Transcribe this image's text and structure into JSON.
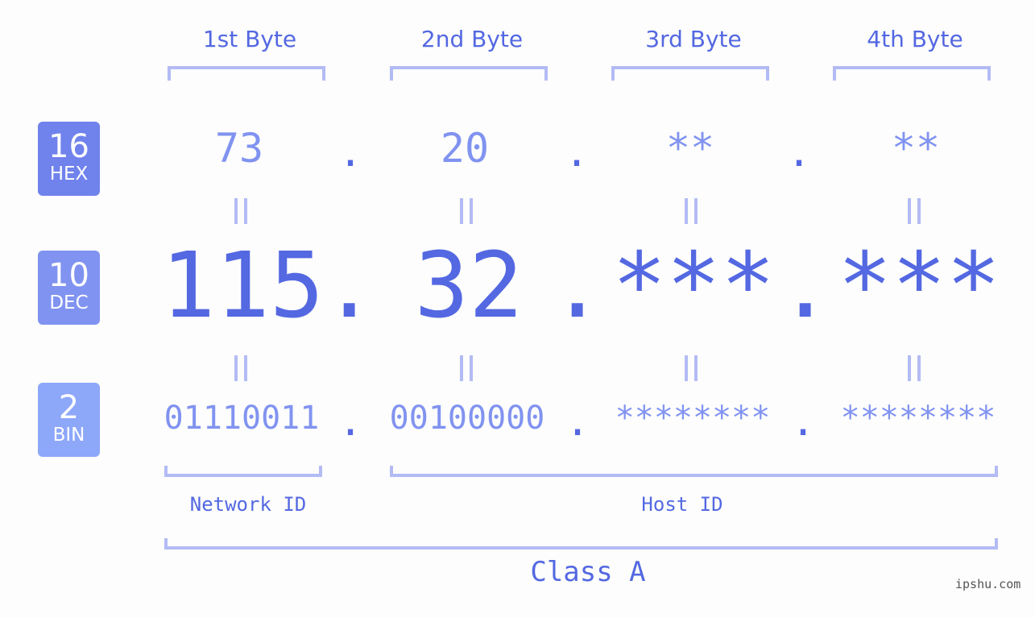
{
  "headers": [
    "1st Byte",
    "2nd Byte",
    "3rd Byte",
    "4th Byte"
  ],
  "badges": [
    {
      "num": "16",
      "label": "HEX",
      "color": "#7082ec"
    },
    {
      "num": "10",
      "label": "DEC",
      "color": "#8093f0"
    },
    {
      "num": "2",
      "label": "BIN",
      "color": "#8da7f9"
    }
  ],
  "hex": [
    "73",
    "20",
    "**",
    "**"
  ],
  "dec": [
    "115",
    "32",
    "***",
    "***"
  ],
  "bin": [
    "01110011",
    "00100000",
    "********",
    "********"
  ],
  "separator": ".",
  "equals_symbol": "=",
  "network_id_label": "Network ID",
  "host_id_label": "Host ID",
  "class_label": "Class A",
  "watermark": "ipshu.com",
  "colors": {
    "primary": "#5468e2",
    "secondary": "#8193f0",
    "bracket": "#b3bbf5",
    "background": "#fcfdfc"
  }
}
